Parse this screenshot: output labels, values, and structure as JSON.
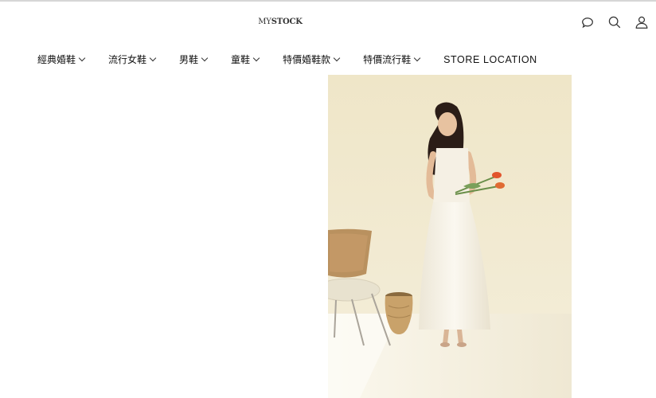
{
  "header": {
    "logo_prefix": "MY",
    "logo_strong": "STOCK",
    "icons": [
      "chat-icon",
      "search-icon",
      "user-icon"
    ]
  },
  "nav": {
    "items": [
      {
        "label": "經典婚鞋"
      },
      {
        "label": "流行女鞋"
      },
      {
        "label": "男鞋"
      },
      {
        "label": "童鞋"
      },
      {
        "label": "特價婚鞋款"
      },
      {
        "label": "特價流行鞋"
      },
      {
        "label": "STORE LOCATION"
      }
    ]
  },
  "hero": {
    "image": "woman-in-white-dress-photo",
    "colors": {
      "wall": "#f2ead2",
      "floor": "#f6f1df",
      "dress": "#f7f3e8"
    }
  }
}
